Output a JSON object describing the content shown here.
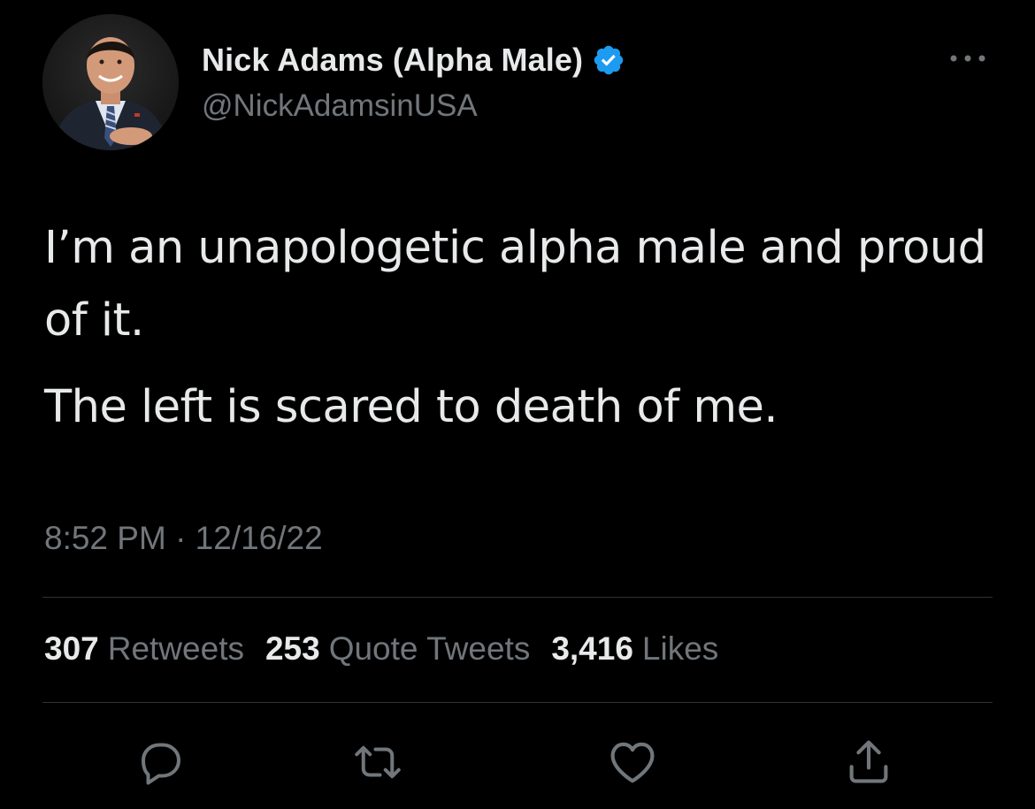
{
  "author": {
    "display_name": "Nick Adams (Alpha Male)",
    "handle": "@NickAdamsinUSA",
    "verified": true,
    "avatar_icon": "profile-photo"
  },
  "tweet": {
    "paragraphs": [
      "I’m an unapologetic alpha male and proud of it.",
      "The left is scared to death of me."
    ],
    "timestamp": "8:52 PM · 12/16/22"
  },
  "stats": {
    "retweets_count": "307",
    "retweets_label": "Retweets",
    "quotes_count": "253",
    "quotes_label": "Quote Tweets",
    "likes_count": "3,416",
    "likes_label": "Likes"
  },
  "actions": [
    "reply-icon",
    "retweet-icon",
    "like-icon",
    "share-icon"
  ],
  "colors": {
    "background": "#000000",
    "text_primary": "#e7e9ea",
    "text_secondary": "#71767b",
    "divider": "#2f3336",
    "verified_badge": "#1d9bf0"
  }
}
